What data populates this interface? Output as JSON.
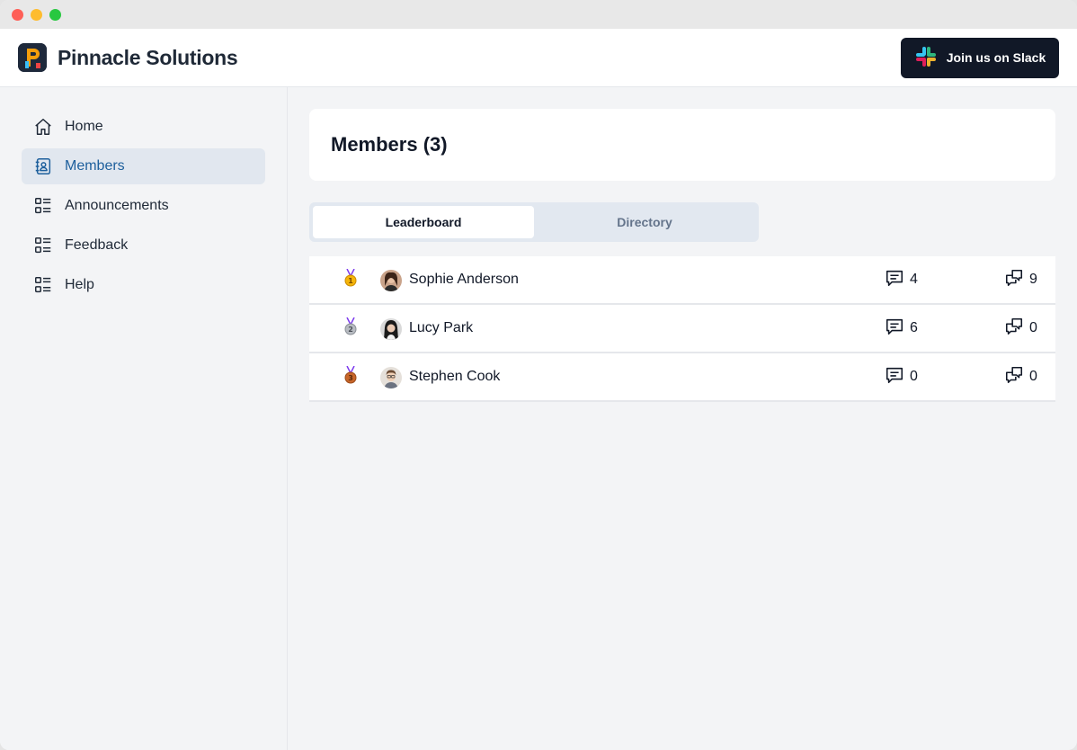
{
  "app": {
    "name": "Pinnacle Solutions",
    "slack_button_label": "Join us on Slack"
  },
  "sidebar": {
    "items": [
      {
        "label": "Home",
        "icon": "home-icon",
        "active": false
      },
      {
        "label": "Members",
        "icon": "contacts-icon",
        "active": true
      },
      {
        "label": "Announcements",
        "icon": "list-icon",
        "active": false
      },
      {
        "label": "Feedback",
        "icon": "list-icon",
        "active": false
      },
      {
        "label": "Help",
        "icon": "list-icon",
        "active": false
      }
    ]
  },
  "page": {
    "title": "Members (3)"
  },
  "tabs": [
    {
      "label": "Leaderboard",
      "active": true
    },
    {
      "label": "Directory",
      "active": false
    }
  ],
  "members": [
    {
      "rank": "1",
      "medal": "gold-medal-icon",
      "name": "Sophie Anderson",
      "comments": "4",
      "replies": "9"
    },
    {
      "rank": "2",
      "medal": "silver-medal-icon",
      "name": "Lucy Park",
      "comments": "6",
      "replies": "0"
    },
    {
      "rank": "3",
      "medal": "bronze-medal-icon",
      "name": "Stephen Cook",
      "comments": "0",
      "replies": "0"
    }
  ],
  "colors": {
    "accent": "#1d5f9c",
    "active_nav_bg": "#e1e7ef",
    "button_bg": "#111827"
  }
}
